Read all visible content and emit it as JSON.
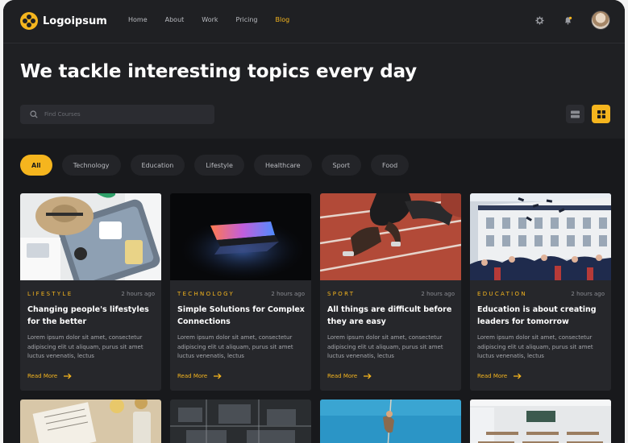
{
  "brand": {
    "name": "Logoipsum"
  },
  "nav": [
    {
      "label": "Home",
      "active": false
    },
    {
      "label": "About",
      "active": false
    },
    {
      "label": "Work",
      "active": false
    },
    {
      "label": "Pricing",
      "active": false
    },
    {
      "label": "Blog",
      "active": true
    }
  ],
  "header_icons": [
    "settings-icon",
    "notification-icon"
  ],
  "hero": {
    "title": "We tackle interesting topics every day"
  },
  "search": {
    "placeholder": "Find Courses",
    "value": ""
  },
  "view": {
    "selected": "grid"
  },
  "categories": [
    {
      "label": "All",
      "active": true
    },
    {
      "label": "Technology",
      "active": false
    },
    {
      "label": "Education",
      "active": false
    },
    {
      "label": "Lifestyle",
      "active": false
    },
    {
      "label": "Healthcare",
      "active": false
    },
    {
      "label": "Sport",
      "active": false
    },
    {
      "label": "Food",
      "active": false
    }
  ],
  "cards": [
    {
      "tag": "LIFESTYLE",
      "time": "2 hours ago",
      "title": "Changing people's lifestyles for the better",
      "desc": "Lorem ipsum dolor sit amet, consectetur adipiscing elit ut aliquam, purus sit amet luctus venenatis, lectus",
      "cta": "Read More"
    },
    {
      "tag": "TECHNOLOGY",
      "time": "2 hours ago",
      "title": "Simple Solutions for Complex Connections",
      "desc": "Lorem ipsum dolor sit amet, consectetur adipiscing elit ut aliquam, purus sit amet luctus venenatis, lectus",
      "cta": "Read More"
    },
    {
      "tag": "SPORT",
      "time": "2 hours ago",
      "title": "All things are difficult before they are easy",
      "desc": "Lorem ipsum dolor sit amet, consectetur adipiscing elit ut aliquam, purus sit amet luctus venenatis, lectus",
      "cta": "Read More"
    },
    {
      "tag": "EDUCATION",
      "time": "2 hours ago",
      "title": "Education is about creating leaders for tomorrow",
      "desc": "Lorem ipsum dolor sit amet, consectetur adipiscing elit ut aliquam, purus sit amet luctus venenatis, lectus",
      "cta": "Read More"
    }
  ],
  "colors": {
    "accent": "#f5b51e",
    "background": "#1f2023",
    "card": "#26272b"
  }
}
